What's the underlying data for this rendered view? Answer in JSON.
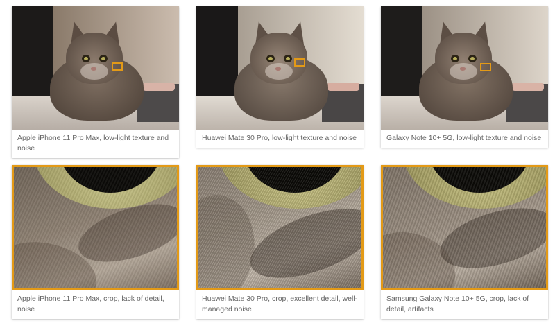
{
  "captions": {
    "top_left": "Apple iPhone 11 Pro Max, low-light texture and noise",
    "top_middle": "Huawei Mate 30 Pro, low-light texture and noise",
    "top_right": "Galaxy Note 10+ 5G, low-light texture and noise",
    "bottom_left": "Apple iPhone 11 Pro Max, crop, lack of detail, noise",
    "bottom_middle": "Huawei Mate 30 Pro, crop, excellent detail, well-managed noise",
    "bottom_right": "Samsung Galaxy Note 10+ 5G, crop, lack of detail, artifacts"
  },
  "colors": {
    "highlight": "#e39a17",
    "caption_text": "#666666"
  }
}
